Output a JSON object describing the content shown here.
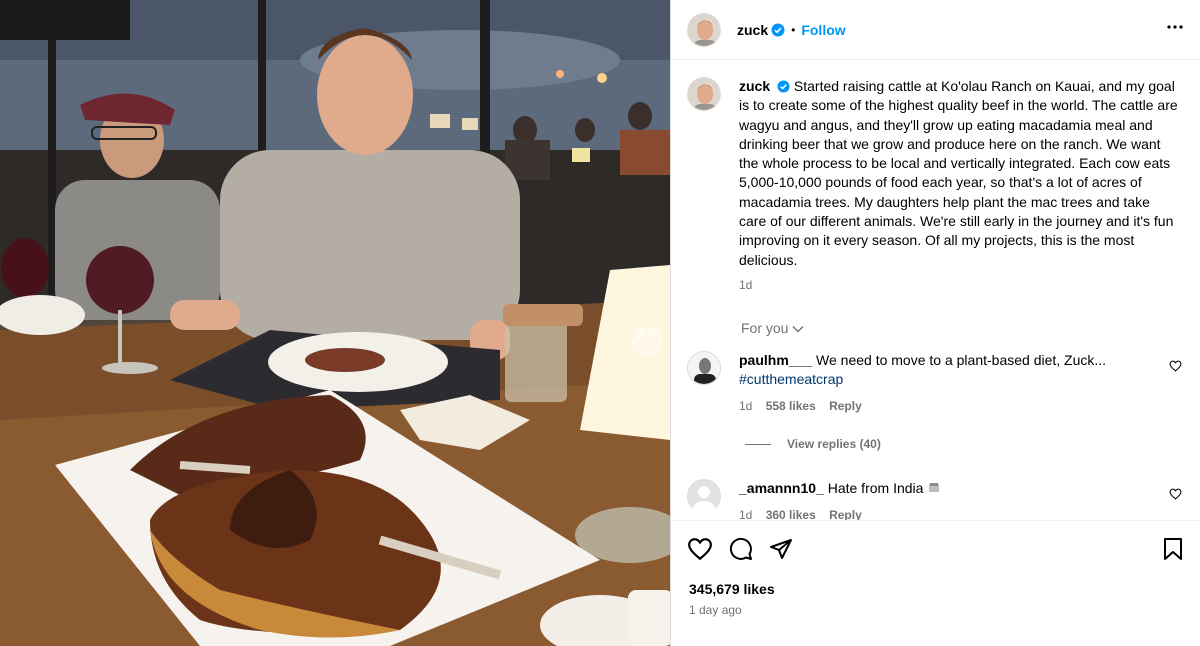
{
  "photo": {
    "alt_icon": "chevron-right-icon"
  },
  "header": {
    "username": "zuck",
    "separator": "•",
    "follow_label": "Follow",
    "verified_icon": "verified-badge-icon",
    "more_icon": "more-options-icon"
  },
  "caption": {
    "username": "zuck",
    "text": "Started raising cattle at Ko'olau Ranch on Kauai, and my goal is to create some of the highest quality beef in the world. The cattle are wagyu and angus, and they'll grow up eating macadamia meal and drinking beer that we grow and produce here on the ranch. We want the whole process to be local and vertically integrated. Each cow eats 5,000-10,000 pounds of food each year, so that's a lot of acres of macadamia trees. My daughters help plant the mac trees and take care of our different animals. We're still early in the journey and it's fun improving on it every season. Of all my projects, this is the most delicious.",
    "age": "1d"
  },
  "comments_filter": {
    "label": "For you"
  },
  "comments": [
    {
      "username": "paulhm___",
      "text": "We need to move to a plant-based diet, Zuck...",
      "hashtag": "#cutthemeatcrap",
      "age": "1d",
      "likes": "558 likes",
      "reply_label": "Reply",
      "view_replies": "View replies (40)"
    },
    {
      "username": "_amannn10_",
      "text": "Hate from India",
      "age": "1d",
      "likes": "360 likes",
      "reply_label": "Reply"
    }
  ],
  "footer": {
    "likes": "345,679 likes",
    "date": "1 day ago"
  },
  "colors": {
    "follow": "#0095f6",
    "secondary_text": "#737373",
    "hashtag": "#00376b",
    "border": "#dbdbdb"
  }
}
